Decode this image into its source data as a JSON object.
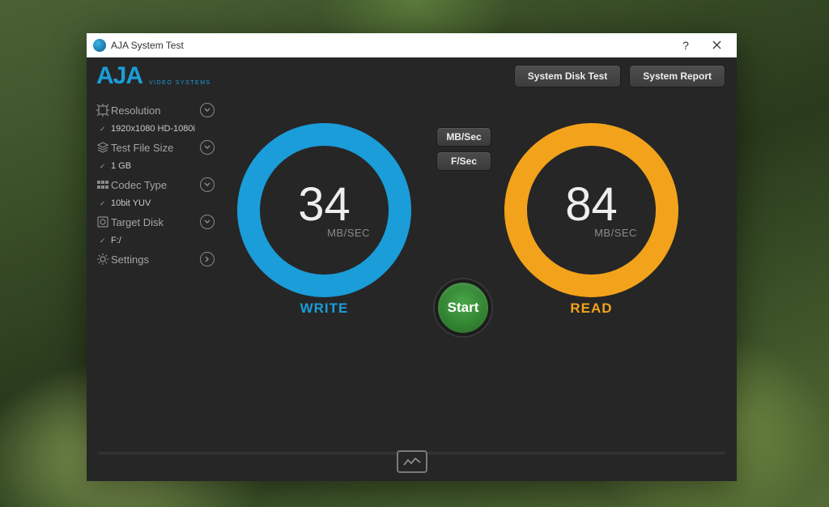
{
  "window": {
    "title": "AJA System Test"
  },
  "brand": {
    "name": "AJA",
    "subtitle": "VIDEO SYSTEMS"
  },
  "tabs": {
    "disk_test": "System Disk Test",
    "report": "System Report"
  },
  "sidebar": {
    "resolution": {
      "label": "Resolution",
      "value": "1920x1080 HD-1080i"
    },
    "file_size": {
      "label": "Test File Size",
      "value": "1 GB"
    },
    "codec": {
      "label": "Codec Type",
      "value": "10bit YUV"
    },
    "disk": {
      "label": "Target Disk",
      "value": "F:/"
    },
    "settings": {
      "label": "Settings"
    }
  },
  "units": {
    "mb_sec": "MB/Sec",
    "f_sec": "F/Sec"
  },
  "gauges": {
    "write": {
      "value": "34",
      "unit": "MB/SEC",
      "label": "WRITE"
    },
    "read": {
      "value": "84",
      "unit": "MB/SEC",
      "label": "READ"
    }
  },
  "start_label": "Start"
}
